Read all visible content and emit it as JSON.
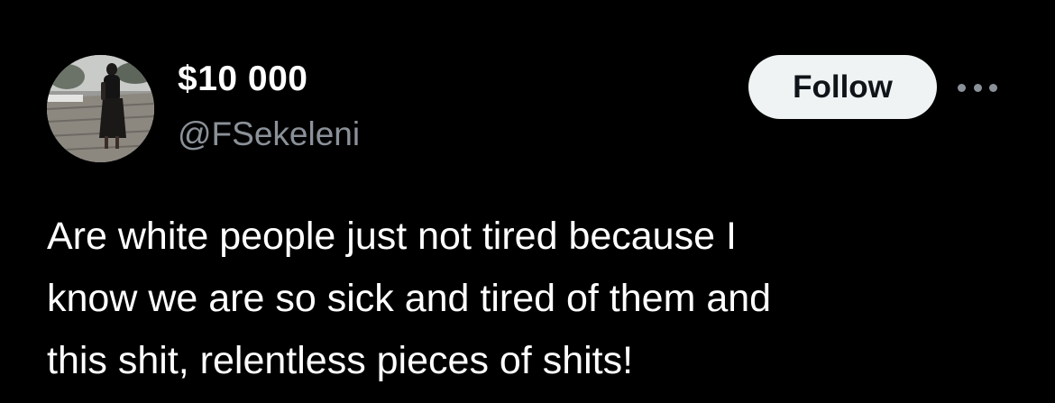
{
  "user": {
    "display_name": "$10 000",
    "handle": "@FSekeleni",
    "avatar_icon": "profile-photo"
  },
  "actions": {
    "follow_label": "Follow",
    "more_icon": "more-horizontal-icon"
  },
  "tweet": {
    "lines": [
      "Are white people just not tired because I",
      "know we are so sick and tired of them and",
      "this shit, relentless pieces of shits!"
    ]
  },
  "colors": {
    "background": "#000000",
    "text": "#ffffff",
    "secondary_text": "#8b9198",
    "follow_button_bg": "#eff3f4",
    "follow_button_text": "#0f1419"
  }
}
